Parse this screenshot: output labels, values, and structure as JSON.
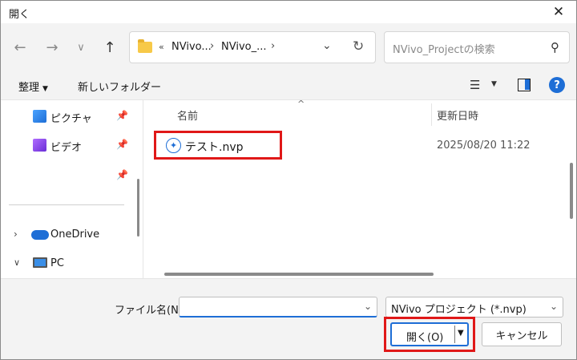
{
  "window": {
    "title": "開く"
  },
  "address": {
    "crumbs": [
      "NVivo...",
      "NVivo_..."
    ],
    "overflow": "«"
  },
  "search": {
    "placeholder": "NVivo_Projectの検索"
  },
  "toolbar": {
    "organize_label": "整理",
    "new_folder_label": "新しいフォルダー"
  },
  "sidebar": {
    "items": [
      {
        "label": "ピクチャ",
        "icon": "pictures-icon"
      },
      {
        "label": "ビデオ",
        "icon": "videos-icon"
      },
      {
        "label": "",
        "icon": "pin-icon"
      },
      {
        "label": "OneDrive",
        "icon": "onedrive-icon"
      },
      {
        "label": "PC",
        "icon": "pc-icon"
      }
    ]
  },
  "file_list": {
    "columns": [
      "名前",
      "更新日時"
    ],
    "rows": [
      {
        "name": "テスト.nvp",
        "modified": "2025/08/20 11:22",
        "icon": "nvivo-icon"
      }
    ]
  },
  "footer": {
    "filename_label": "ファイル名(N):",
    "filename_value": "",
    "filter_value": "NVivo プロジェクト (*.nvp)",
    "open_label": "開く(O)",
    "cancel_label": "キャンセル"
  },
  "colors": {
    "accent": "#1e6ed6",
    "highlight": "#e01818"
  }
}
